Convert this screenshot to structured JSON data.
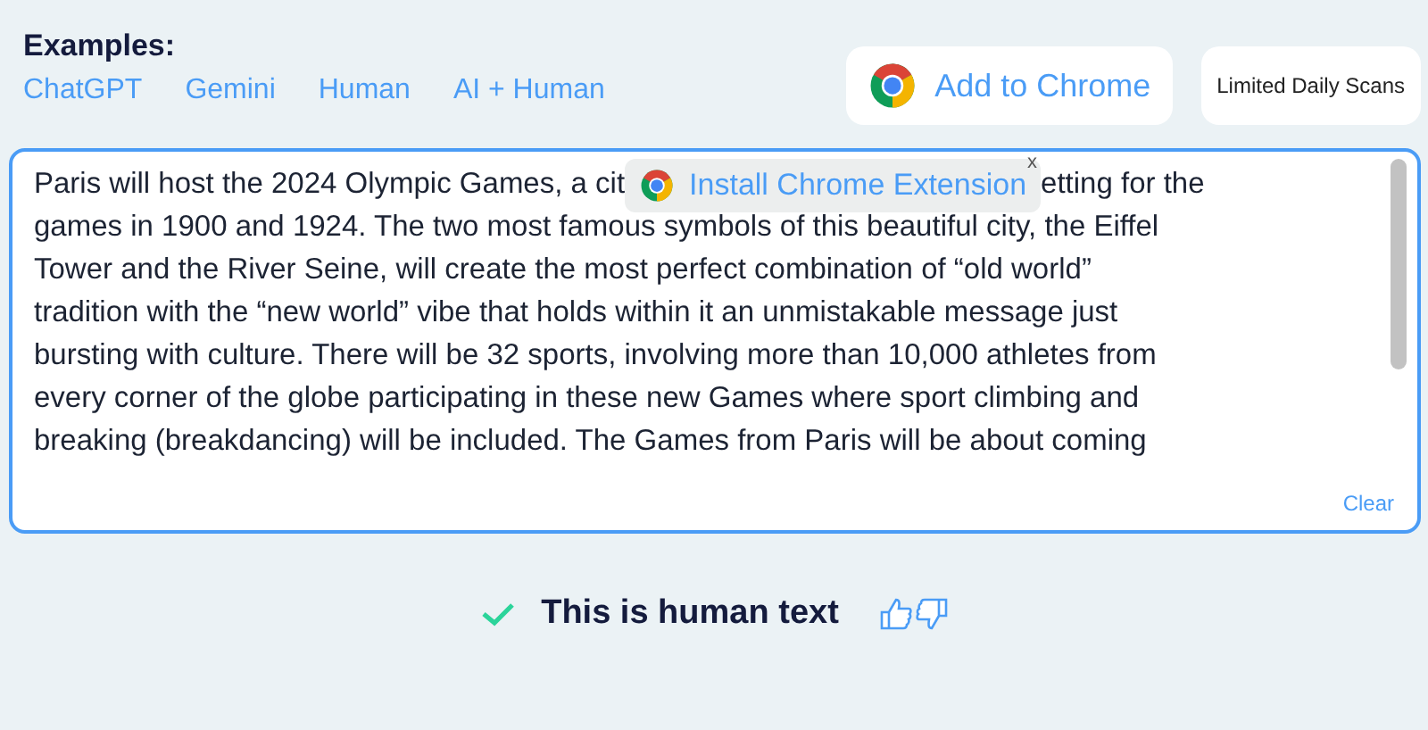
{
  "examples": {
    "title": "Examples:",
    "links": [
      "ChatGPT",
      "Gemini",
      "Human",
      "AI + Human"
    ]
  },
  "add_to_chrome": "Add to Chrome",
  "limited_scans": "Limited Daily Scans",
  "editor": {
    "first_line_left": "Paris will host the 2024 Olympic Games,  a cit",
    "first_line_right": "etting for the",
    "lines": [
      "games in 1900 and 1924. The two most famous symbols of this beautiful city, the Eiffel",
      "Tower and the River Seine, will create the most perfect combination of “old world”",
      "tradition with the “new world” vibe that holds within it an unmistakable message just",
      "bursting with culture. There will be 32 sports, involving more than 10,000 athletes from",
      "every corner of the globe participating in these new Games where sport climbing and",
      "breaking (breakdancing) will be included. The Games from Paris will be about coming"
    ],
    "clear": "Clear",
    "popup": {
      "label": "Install Chrome Extension",
      "close": "x"
    }
  },
  "result": {
    "kind": "human",
    "text": "This is human text"
  }
}
